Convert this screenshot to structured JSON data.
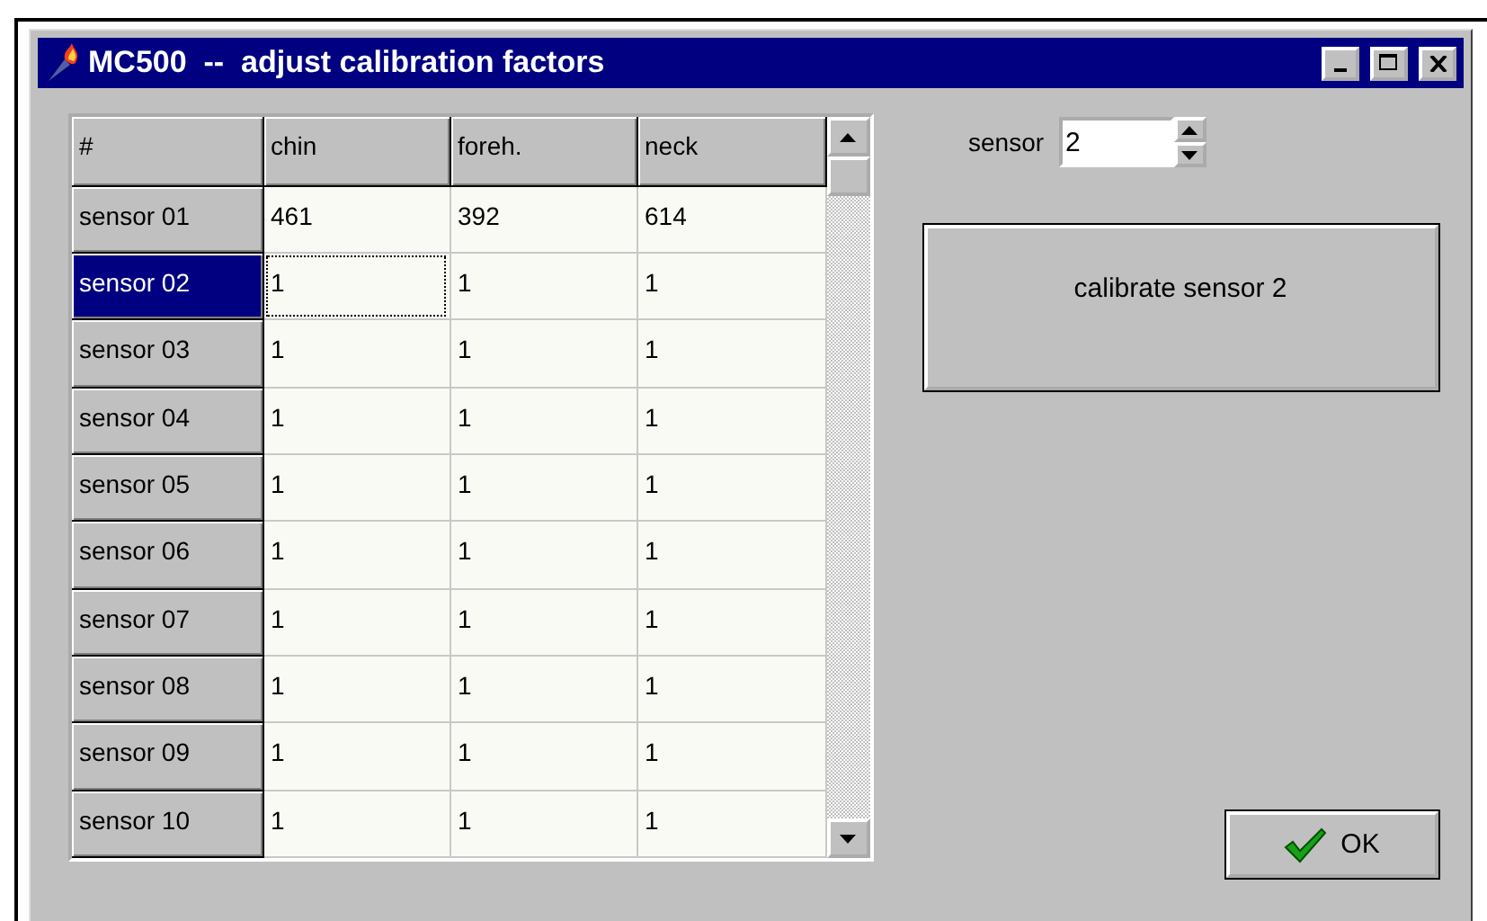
{
  "window": {
    "title": "MC500  --  adjust calibration factors"
  },
  "table": {
    "corner": "#",
    "columns": [
      "chin",
      "foreh.",
      "neck"
    ],
    "rows": [
      {
        "label": "sensor 01",
        "selected": false,
        "cells": [
          {
            "text": "461",
            "focused": false
          },
          {
            "text": "392",
            "focused": false
          },
          {
            "text": "614",
            "focused": false
          }
        ]
      },
      {
        "label": "sensor 02",
        "selected": true,
        "cells": [
          {
            "text": "1",
            "focused": true
          },
          {
            "text": "1",
            "focused": false
          },
          {
            "text": "1",
            "focused": false
          }
        ]
      },
      {
        "label": "sensor 03",
        "selected": false,
        "cells": [
          {
            "text": "1",
            "focused": false
          },
          {
            "text": "1",
            "focused": false
          },
          {
            "text": "1",
            "focused": false
          }
        ]
      },
      {
        "label": "sensor 04",
        "selected": false,
        "cells": [
          {
            "text": "1",
            "focused": false
          },
          {
            "text": "1",
            "focused": false
          },
          {
            "text": "1",
            "focused": false
          }
        ]
      },
      {
        "label": "sensor 05",
        "selected": false,
        "cells": [
          {
            "text": "1",
            "focused": false
          },
          {
            "text": "1",
            "focused": false
          },
          {
            "text": "1",
            "focused": false
          }
        ]
      },
      {
        "label": "sensor 06",
        "selected": false,
        "cells": [
          {
            "text": "1",
            "focused": false
          },
          {
            "text": "1",
            "focused": false
          },
          {
            "text": "1",
            "focused": false
          }
        ]
      },
      {
        "label": "sensor 07",
        "selected": false,
        "cells": [
          {
            "text": "1",
            "focused": false
          },
          {
            "text": "1",
            "focused": false
          },
          {
            "text": "1",
            "focused": false
          }
        ]
      },
      {
        "label": "sensor 08",
        "selected": false,
        "cells": [
          {
            "text": "1",
            "focused": false
          },
          {
            "text": "1",
            "focused": false
          },
          {
            "text": "1",
            "focused": false
          }
        ]
      },
      {
        "label": "sensor 09",
        "selected": false,
        "cells": [
          {
            "text": "1",
            "focused": false
          },
          {
            "text": "1",
            "focused": false
          },
          {
            "text": "1",
            "focused": false
          }
        ]
      },
      {
        "label": "sensor 10",
        "selected": false,
        "cells": [
          {
            "text": "1",
            "focused": false
          },
          {
            "text": "1",
            "focused": false
          },
          {
            "text": "1",
            "focused": false
          }
        ]
      }
    ]
  },
  "sensor": {
    "label": "sensor",
    "value": "2"
  },
  "calibrate_button": "calibrate sensor 2",
  "ok_button": "OK"
}
